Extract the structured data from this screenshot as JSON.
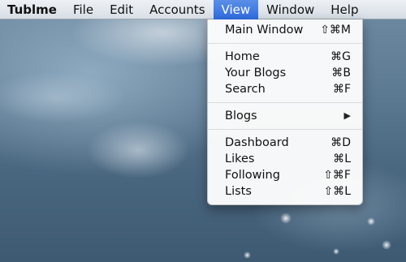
{
  "menubar": {
    "items": [
      {
        "label": "Tublme"
      },
      {
        "label": "File"
      },
      {
        "label": "Edit"
      },
      {
        "label": "Accounts"
      },
      {
        "label": "View"
      },
      {
        "label": "Window"
      },
      {
        "label": "Help"
      }
    ]
  },
  "view_menu": {
    "groups": [
      [
        {
          "label": "Main Window",
          "shortcut": "⇧⌘M"
        }
      ],
      [
        {
          "label": "Home",
          "shortcut": "⌘G"
        },
        {
          "label": "Your Blogs",
          "shortcut": "⌘B"
        },
        {
          "label": "Search",
          "shortcut": "⌘F"
        }
      ],
      [
        {
          "label": "Blogs",
          "submenu_indicator": "▶"
        }
      ],
      [
        {
          "label": "Dashboard",
          "shortcut": "⌘D"
        },
        {
          "label": "Likes",
          "shortcut": "⌘L"
        },
        {
          "label": "Following",
          "shortcut": "⇧⌘F"
        },
        {
          "label": "Lists",
          "shortcut": "⇧⌘L"
        }
      ]
    ]
  },
  "colors": {
    "highlight": "#2f6be0",
    "menubar_bg": "#e6eaef",
    "menu_bg": "#fcfcfc"
  }
}
